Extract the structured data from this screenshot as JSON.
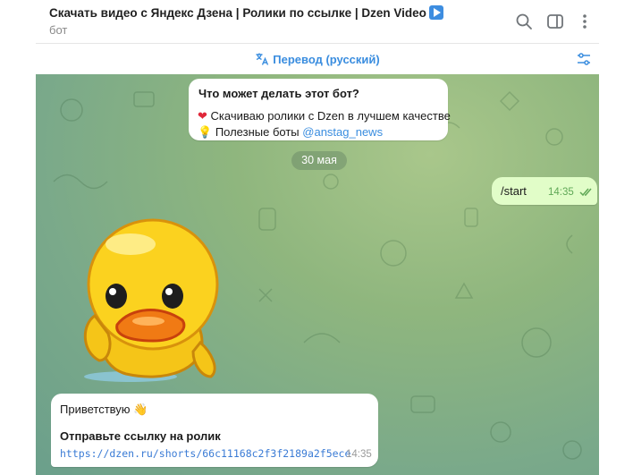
{
  "header": {
    "title": "Скачать видео с Яндекс Дзена | Ролики по ссылке | Dzen Video",
    "subtitle": "бот"
  },
  "icons": {
    "search": "search-icon",
    "sidebar": "sidebar-toggle-icon",
    "more": "more-vertical-icon",
    "translate": "translate-icon",
    "settings": "sliders-icon",
    "heart": "heart-emoji",
    "bulb": "lightbulb-emoji",
    "wave": "waving-hand-emoji",
    "play": "play-button-emoji"
  },
  "translate_bar": {
    "label": "Перевод (русский)"
  },
  "bot_info": {
    "question": "Что может делать этот бот?",
    "line1": "Скачиваю ролики с Dzen в лучшем качестве",
    "line2_prefix": "Полезные боты ",
    "line2_link": "@anstag_news"
  },
  "date_separator": "30 мая",
  "outgoing": {
    "text": "/start",
    "time": "14:35"
  },
  "incoming": {
    "greeting": "Приветствую",
    "instruction": "Отправьте ссылку на ролик",
    "url": "https://dzen.ru/shorts/66c11168c2f3f2189a2f5ece",
    "time": "14:35"
  },
  "colors": {
    "accent": "#3a8ddf",
    "outgoing_bubble": "#e1fdc8",
    "chat_bg": "#8fb67e"
  }
}
